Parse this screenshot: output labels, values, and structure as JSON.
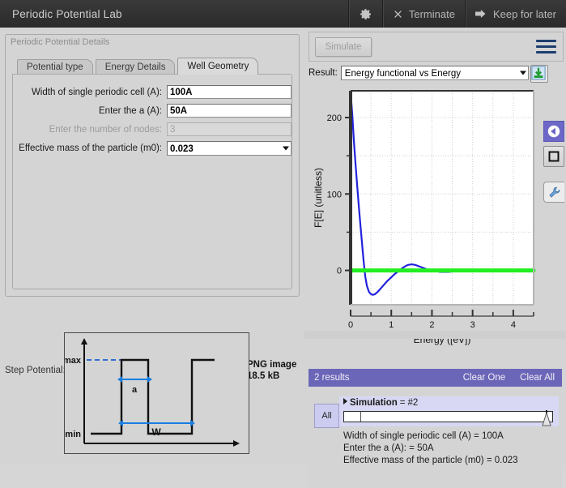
{
  "titlebar": {
    "title": "Periodic Potential Lab",
    "gear_icon": "gear-icon",
    "terminate_label": "Terminate",
    "terminate_icon": "close-x-icon",
    "keep_label": "Keep for later",
    "keep_icon": "arrow-right-icon"
  },
  "left": {
    "group_title": "Periodic Potential Details",
    "tabs": [
      {
        "label": "Potential type",
        "active": false
      },
      {
        "label": "Energy Details",
        "active": false
      },
      {
        "label": "Well Geometry",
        "active": true
      }
    ],
    "fields": [
      {
        "label": "Width of single periodic cell (A):",
        "value": "100A",
        "type": "text",
        "disabled": false
      },
      {
        "label": "Enter the a (A):",
        "value": "50A",
        "type": "text",
        "disabled": false
      },
      {
        "label": "Enter the number of nodes:",
        "value": "3",
        "type": "text",
        "disabled": true
      },
      {
        "label": "Effective mass of the particle (m0):",
        "value": "0.023",
        "type": "select",
        "disabled": false
      }
    ],
    "image": {
      "caption": "Step Potential:",
      "meta_line1": "PNG image",
      "meta_line2": "18.5 kB",
      "diagram_labels": {
        "vmax": "Vmax",
        "vmin": "Vmin",
        "a": "a",
        "w": "W"
      }
    }
  },
  "right": {
    "simulate_label": "Simulate",
    "menu_icon": "hamburger-menu-icon",
    "result_label": "Result:",
    "result_value": "Energy functional vs Energy",
    "download_icon": "download-icon",
    "tools": {
      "back_icon": "back-arrow-icon",
      "square_icon": "square-icon",
      "wrench_icon": "wrench-icon"
    },
    "results": {
      "count_label": "2 results",
      "clear_one_label": "Clear One",
      "clear_all_label": "Clear All",
      "all_button_label": "All",
      "sim_name": "Simulation",
      "sim_eq": "=",
      "sim_value": "#2",
      "details": [
        "Width of single periodic cell (A) = 100A",
        "Enter the a (A): = 50A",
        "Effective mass of the particle (m0) = 0.023"
      ]
    }
  },
  "chart_data": {
    "type": "line",
    "title": "",
    "xlabel": "Energy ([eV])",
    "ylabel": "F[E] (unitless)",
    "xlim": [
      0,
      4.5
    ],
    "ylim": [
      -45,
      235
    ],
    "xticks": [
      0,
      1,
      2,
      3,
      4
    ],
    "xticks_minor": [
      0.5,
      1.5,
      2.5,
      3.5,
      4.5
    ],
    "yticks": [
      0,
      100,
      200
    ],
    "yticks_minor": [
      50,
      150
    ],
    "grid": true,
    "legend": "none",
    "series": [
      {
        "name": "F[E]",
        "color": "#2222dd",
        "x": [
          0.0,
          0.04,
          0.08,
          0.12,
          0.16,
          0.2,
          0.24,
          0.28,
          0.32,
          0.36,
          0.4,
          0.45,
          0.5,
          0.55,
          0.6,
          0.65,
          0.7,
          0.8,
          0.9,
          1.0,
          1.1,
          1.2,
          1.3,
          1.4,
          1.5,
          1.6,
          1.7,
          1.8,
          1.9,
          2.0,
          2.2,
          2.4,
          2.6,
          2.8,
          3.0,
          3.2,
          3.4,
          3.6,
          3.8,
          4.0,
          4.2,
          4.4,
          4.5
        ],
        "y": [
          232,
          205,
          170,
          140,
          112,
          85,
          60,
          36,
          12,
          -8,
          -20,
          -28,
          -31,
          -32,
          -31,
          -29,
          -26,
          -20,
          -14,
          -9,
          -4,
          0,
          4,
          7,
          8,
          7,
          5,
          3,
          1,
          0,
          -2,
          -2,
          -1,
          0,
          0,
          -1,
          -1,
          0,
          0,
          -1,
          -1,
          0,
          0
        ]
      },
      {
        "name": "zero-line",
        "color": "#22ee22",
        "x": [
          0,
          4.5
        ],
        "y": [
          0,
          0
        ]
      }
    ]
  }
}
